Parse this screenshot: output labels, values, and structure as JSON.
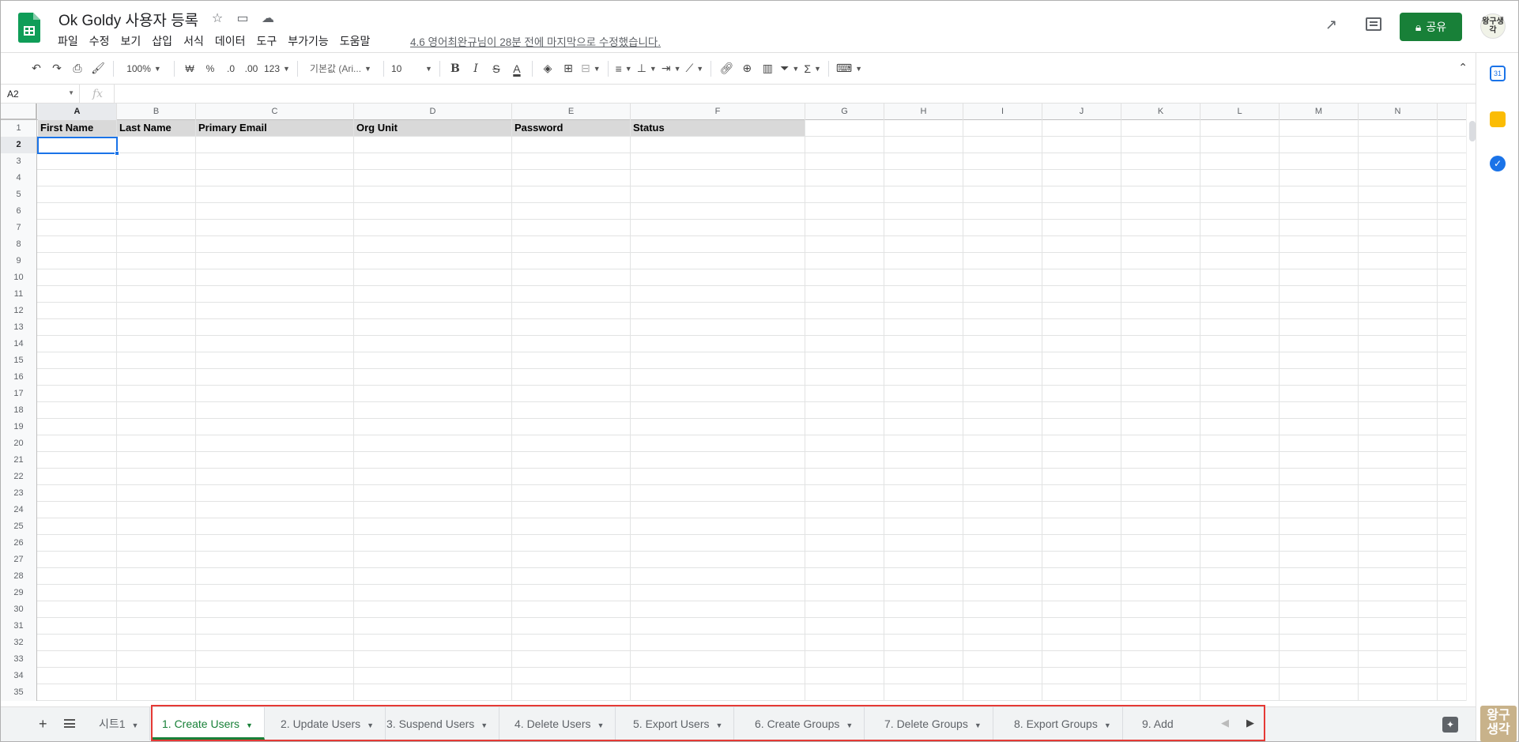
{
  "doc": {
    "title": "Ok Goldy 사용자 등록",
    "last_edit": "4.6 영어최완규님이 28분 전에 마지막으로 수정했습니다."
  },
  "menu": [
    "파일",
    "수정",
    "보기",
    "삽입",
    "서식",
    "데이터",
    "도구",
    "부가기능",
    "도움말"
  ],
  "header": {
    "share_label": "공유",
    "avatar_text": "왕구생각"
  },
  "toolbar": {
    "zoom": "100%",
    "currency": "₩",
    "percent": "%",
    "dec_less": ".0",
    "dec_more": ".00",
    "format_more": "123",
    "font": "기본값 (Ari...",
    "font_size": "10",
    "bold": "B",
    "italic": "I",
    "strike": "S",
    "text_color": "A",
    "sigma": "Σ"
  },
  "formula_bar": {
    "cell_ref": "A2",
    "fx": "fx",
    "value": ""
  },
  "columns": [
    "A",
    "B",
    "C",
    "D",
    "E",
    "F",
    "G",
    "H",
    "I",
    "J",
    "K",
    "L",
    "M",
    "N"
  ],
  "selected_column": "A",
  "header_row": [
    "First Name",
    "Last Name",
    "Primary Email",
    "Org Unit",
    "Password",
    "Status"
  ],
  "row_numbers": [
    "1",
    "2",
    "3",
    "4",
    "5",
    "6",
    "7",
    "8",
    "9",
    "10",
    "11",
    "12",
    "13",
    "14",
    "15",
    "16",
    "17",
    "18",
    "19",
    "20",
    "21",
    "22",
    "23",
    "24",
    "25",
    "26",
    "27",
    "28",
    "29",
    "30",
    "31",
    "32",
    "33",
    "34",
    "35"
  ],
  "selected_row": "2",
  "sheets": [
    {
      "label": "시트1",
      "active": false
    },
    {
      "label": "1. Create Users",
      "active": true
    },
    {
      "label": "2. Update Users",
      "active": false
    },
    {
      "label": "3. Suspend Users",
      "active": false
    },
    {
      "label": "4. Delete Users",
      "active": false
    },
    {
      "label": "5. Export Users",
      "active": false
    },
    {
      "label": "6. Create Groups",
      "active": false
    },
    {
      "label": "7. Delete Groups",
      "active": false
    },
    {
      "label": "8. Export Groups",
      "active": false
    },
    {
      "label": "9. Add",
      "active": false
    }
  ],
  "watermark_text": "왕구생각",
  "colors": {
    "brand_green": "#188038",
    "selection_blue": "#1a73e8",
    "highlight_red": "#e53935",
    "header_fill": "#d9d9d9"
  }
}
